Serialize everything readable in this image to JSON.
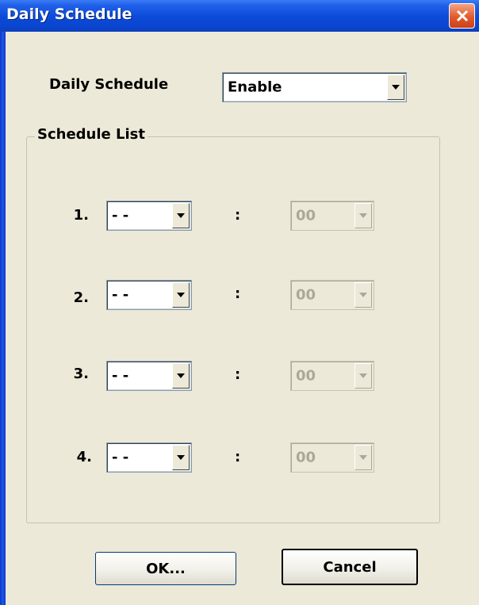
{
  "window": {
    "title": "Daily Schedule",
    "close_icon": "close-icon"
  },
  "daily_schedule": {
    "label": "Daily Schedule",
    "selected": "Enable"
  },
  "schedule_list": {
    "legend": "Schedule List",
    "rows": [
      {
        "number": "1.",
        "hour": "- -",
        "separator": ":",
        "minute": "00"
      },
      {
        "number": "2.",
        "hour": "- -",
        "separator": ":",
        "minute": "00"
      },
      {
        "number": "3.",
        "hour": "- -",
        "separator": ":",
        "minute": "00"
      },
      {
        "number": "4.",
        "hour": "- -",
        "separator": ":",
        "minute": "00"
      }
    ]
  },
  "buttons": {
    "ok_label": "OK...",
    "cancel_label": "Cancel"
  },
  "colors": {
    "titlebar": "#0b4ad8",
    "dialog_bg": "#ece9d8",
    "close_button": "#e35a2a"
  }
}
